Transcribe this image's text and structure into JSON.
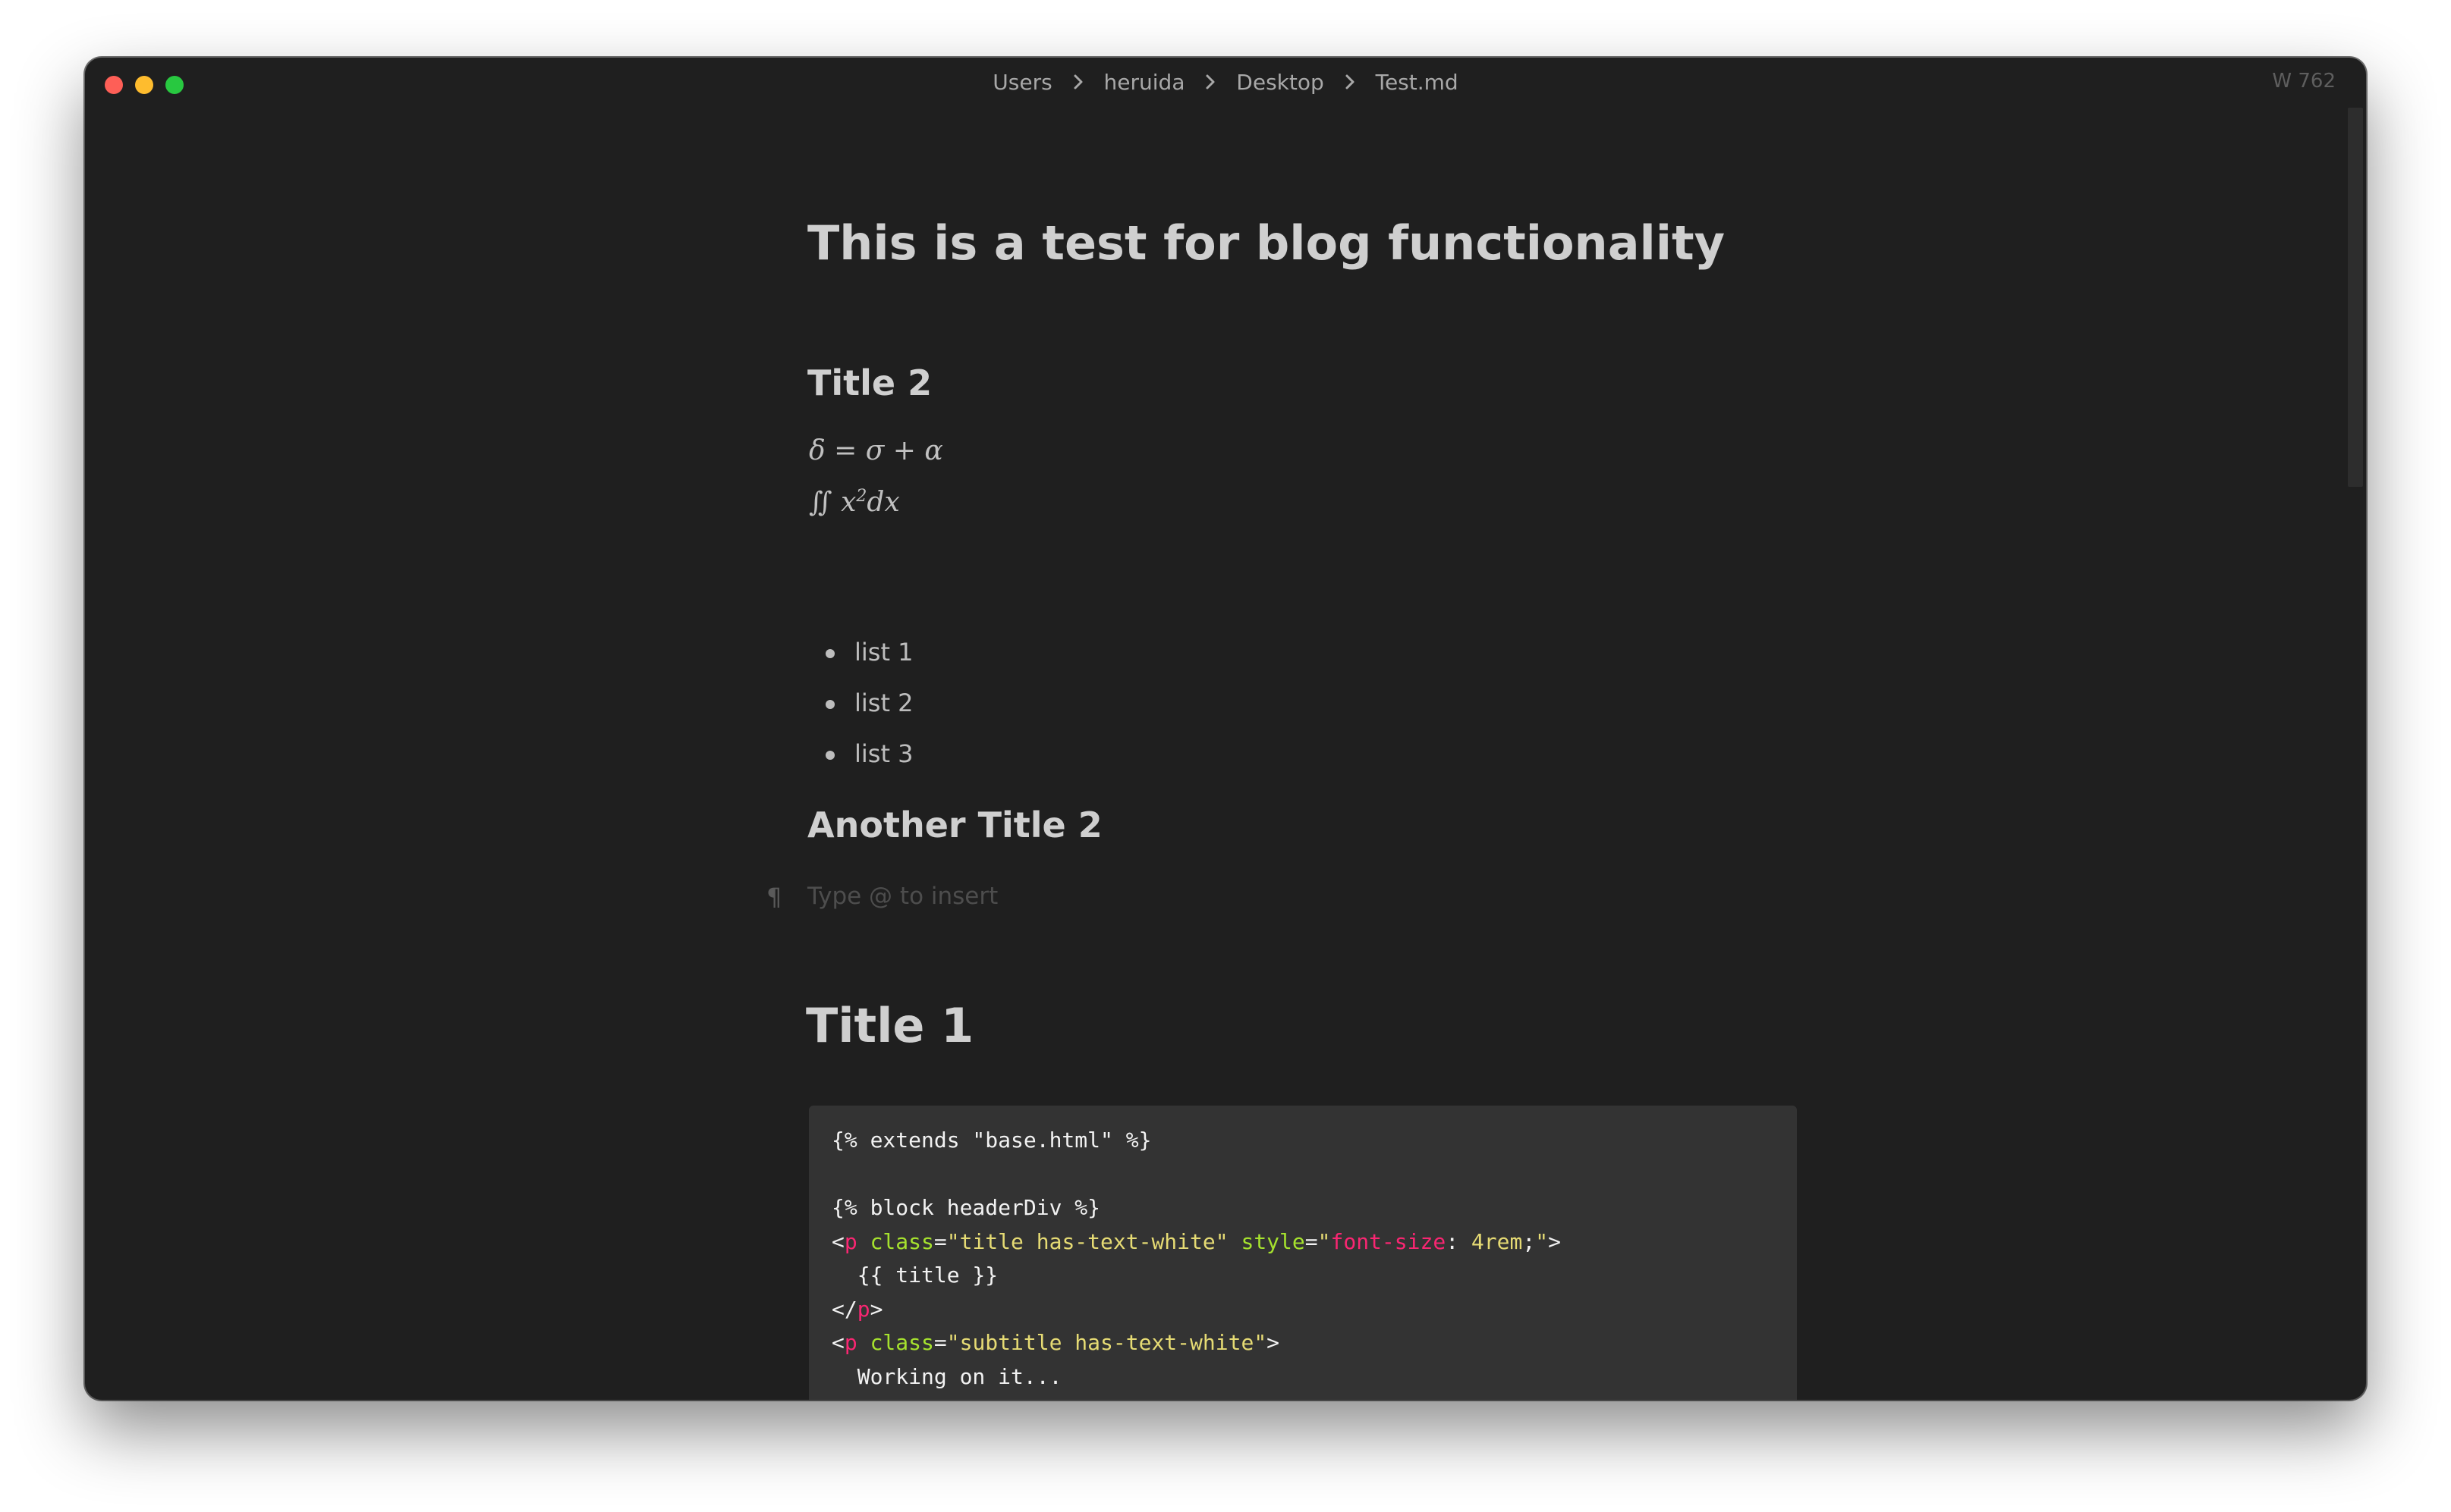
{
  "window": {
    "breadcrumb": [
      "Users",
      "heruida",
      "Desktop",
      "Test.md"
    ],
    "word_count": "W 762"
  },
  "document": {
    "title": "This is a test for blog functionality",
    "heading_title2": "Title 2",
    "math_line1": "δ = σ + α",
    "math_line2_pre": "∬ x",
    "math_line2_sup": "2",
    "math_line2_post": "dx",
    "list_items": [
      "list 1",
      "list 2",
      "list 3"
    ],
    "heading_another": "Another Title 2",
    "paragraph_mark": "¶",
    "insert_placeholder": "Type @ to insert",
    "heading_title1": "Title 1",
    "code_lines": [
      [
        {
          "t": "{% extends \"base.html\" %}",
          "k": ""
        }
      ],
      [
        {
          "t": "",
          "k": ""
        }
      ],
      [
        {
          "t": "{% block headerDiv %}",
          "k": ""
        }
      ],
      [
        {
          "t": "<",
          "k": ""
        },
        {
          "t": "p",
          "k": "tag"
        },
        {
          "t": " ",
          "k": ""
        },
        {
          "t": "class",
          "k": "attr"
        },
        {
          "t": "=",
          "k": ""
        },
        {
          "t": "\"title has-text-white\"",
          "k": "str"
        },
        {
          "t": " ",
          "k": ""
        },
        {
          "t": "style",
          "k": "attr"
        },
        {
          "t": "=",
          "k": ""
        },
        {
          "t": "\"",
          "k": "str"
        },
        {
          "t": "font-size",
          "k": "prop"
        },
        {
          "t": ": ",
          "k": ""
        },
        {
          "t": "4rem",
          "k": "num"
        },
        {
          "t": ";",
          "k": ""
        },
        {
          "t": "\"",
          "k": "str"
        },
        {
          "t": ">",
          "k": ""
        }
      ],
      [
        {
          "t": "  {{ title }}",
          "k": ""
        }
      ],
      [
        {
          "t": "</",
          "k": ""
        },
        {
          "t": "p",
          "k": "tag"
        },
        {
          "t": ">",
          "k": ""
        }
      ],
      [
        {
          "t": "<",
          "k": ""
        },
        {
          "t": "p",
          "k": "tag"
        },
        {
          "t": " ",
          "k": ""
        },
        {
          "t": "class",
          "k": "attr"
        },
        {
          "t": "=",
          "k": ""
        },
        {
          "t": "\"subtitle has-text-white\"",
          "k": "str"
        },
        {
          "t": ">",
          "k": ""
        }
      ],
      [
        {
          "t": "  Working on it...",
          "k": ""
        }
      ]
    ]
  },
  "icons": {
    "breadcrumb_separator": "chevron-right-icon",
    "traffic_lights": [
      "close",
      "minimize",
      "maximize"
    ]
  },
  "colors": {
    "close": "#fe5f57",
    "minimize": "#febc2e",
    "maximize": "#28c840",
    "editor_background": "#1f1f1f",
    "code_background": "#333333"
  }
}
